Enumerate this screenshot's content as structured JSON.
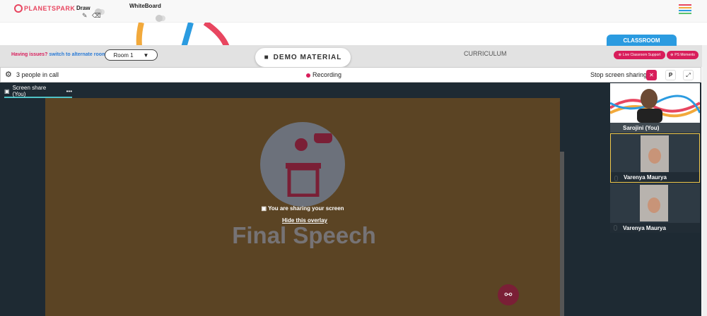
{
  "brand": {
    "logo": "PLANETSPARK"
  },
  "toolbar": {
    "draw_label": "Draw",
    "whiteboard_label": "WhiteBoard"
  },
  "notice": {
    "issues": "Having issues?",
    "switch_link": "switch to alternate room"
  },
  "room": {
    "selected": "Room 1"
  },
  "demo": {
    "label": "DEMO MATERIAL"
  },
  "curriculum": {
    "label": "CURRICULUM"
  },
  "classroom": {
    "tab": "CLASSROOM",
    "live_support": "Live Classroom Support",
    "ps_moments": "PS Moments"
  },
  "call": {
    "people": "3 people in call",
    "recording": "Recording",
    "stop_sharing": "Stop screen sharing",
    "p_label": "P"
  },
  "share": {
    "tab": "Screen share (You)",
    "overlay_text": "You are sharing your screen",
    "hide_link": "Hide this overlay",
    "slide_title": "Final Speech"
  },
  "participants": [
    {
      "name": "Sarojini (You)"
    },
    {
      "name": "Varenya Maurya"
    },
    {
      "name": "Varenya Maurya"
    }
  ],
  "colors": {
    "accent": "#d81e5b",
    "brand_red": "#e84660",
    "slide_bg": "#5b4424",
    "dark": "#1e2a33",
    "highlight": "#f2c94c"
  }
}
